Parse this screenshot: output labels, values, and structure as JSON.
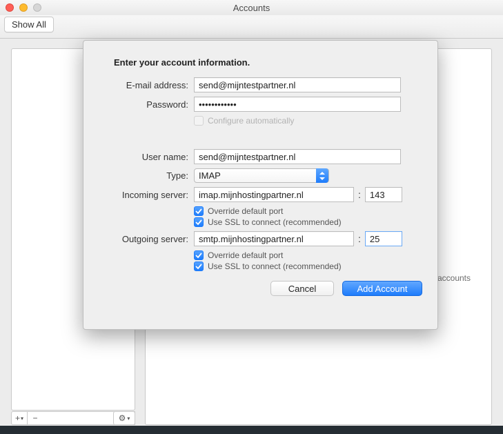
{
  "window": {
    "title": "Accounts"
  },
  "toolbar": {
    "show_all": "Show All"
  },
  "sheet": {
    "title": "Enter your account information.",
    "labels": {
      "email": "E-mail address:",
      "password": "Password:",
      "configure_auto": "Configure automatically",
      "username": "User name:",
      "type": "Type:",
      "incoming": "Incoming server:",
      "outgoing": "Outgoing server:",
      "override_port": "Override default port",
      "use_ssl": "Use SSL to connect (recommended)"
    },
    "values": {
      "email": "send@mijntestpartner.nl",
      "password": "••••••••••••",
      "username": "send@mijntestpartner.nl",
      "type": "IMAP",
      "incoming_host": "imap.mijnhostingpartner.nl",
      "incoming_port": "143",
      "outgoing_host": "smtp.mijnhostingpartner.nl",
      "outgoing_port": "25"
    },
    "checks": {
      "configure_auto_checked": false,
      "incoming_override_port": true,
      "incoming_use_ssl": true,
      "outgoing_override_port": true,
      "outgoing_use_ssl": true
    },
    "buttons": {
      "cancel": "Cancel",
      "add": "Add Account"
    }
  },
  "right_panel": {
    "hint_fragment": "t accounts"
  },
  "sidebar_controls": {
    "add_icon": "+",
    "remove_icon": "−",
    "gear_icon": "⚙",
    "dropdown_icon": "▾"
  }
}
